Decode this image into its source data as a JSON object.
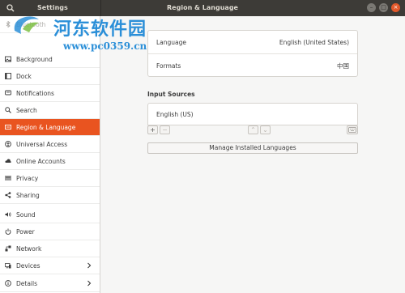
{
  "window": {
    "app_title": "Settings",
    "panel_title": "Region & Language",
    "minimize_glyph": "–",
    "maximize_glyph": "□",
    "close_glyph": "×"
  },
  "watermark": {
    "title": "河东软件园",
    "url": "www.pc0359.cn"
  },
  "sidebar": {
    "items": [
      {
        "label": "Bluetooth",
        "icon": "bluetooth-icon"
      },
      {
        "label": "Background",
        "icon": "background-icon"
      },
      {
        "label": "Dock",
        "icon": "dock-icon"
      },
      {
        "label": "Notifications",
        "icon": "notifications-icon"
      },
      {
        "label": "Search",
        "icon": "search-icon"
      },
      {
        "label": "Region & Language",
        "icon": "region-icon",
        "active": true
      },
      {
        "label": "Universal Access",
        "icon": "universal-access-icon"
      },
      {
        "label": "Online Accounts",
        "icon": "online-accounts-icon"
      },
      {
        "label": "Privacy",
        "icon": "privacy-icon"
      },
      {
        "label": "Sharing",
        "icon": "sharing-icon"
      },
      {
        "label": "Sound",
        "icon": "sound-icon"
      },
      {
        "label": "Power",
        "icon": "power-icon"
      },
      {
        "label": "Network",
        "icon": "network-icon"
      },
      {
        "label": "Devices",
        "icon": "devices-icon",
        "chevron": true
      },
      {
        "label": "Details",
        "icon": "details-icon",
        "chevron": true
      }
    ]
  },
  "language_panel": {
    "language_label": "Language",
    "language_value": "English (United States)",
    "formats_label": "Formats",
    "formats_value": "中国"
  },
  "input_sources": {
    "section_title": "Input Sources",
    "sources": [
      "English (US)"
    ],
    "add_glyph": "+",
    "remove_glyph": "−",
    "up_glyph": "⌃",
    "down_glyph": "⌄",
    "manage_label": "Manage Installed Languages"
  },
  "colors": {
    "accent": "#e95420",
    "headerbar": "#3d3b37",
    "watermark": "#2b8fd8"
  }
}
